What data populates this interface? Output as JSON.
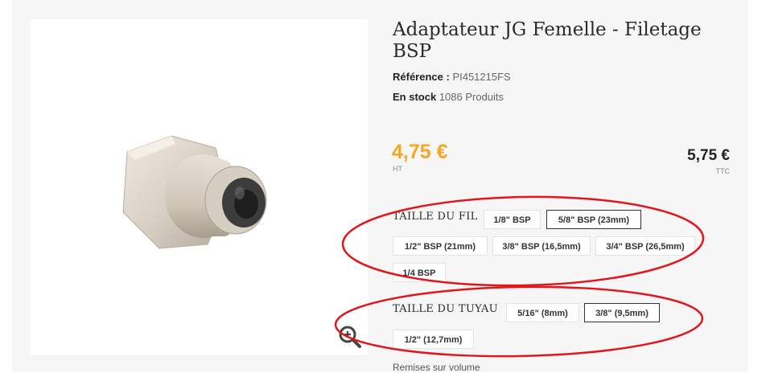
{
  "product": {
    "title": "Adaptateur JG Femelle - Filetage BSP",
    "reference_label": "Référence :",
    "reference_value": "PI451215FS",
    "stock_label": "En stock",
    "stock_value": "1086 Produits"
  },
  "price": {
    "ht_value": "4,75 €",
    "ht_label": "HT",
    "ttc_value": "5,75 €",
    "ttc_label": "TTC",
    "accent_color": "#f5a623"
  },
  "options": {
    "fil": {
      "label": "TAILLE DU FIL",
      "choices": [
        "1/8\" BSP",
        "5/8\" BSP (23mm)",
        "1/2\" BSP (21mm)",
        "3/8\" BSP (16,5mm)",
        "3/4\" BSP (26,5mm)",
        "1/4 BSP"
      ],
      "selected": "5/8\" BSP (23mm)"
    },
    "tuyau": {
      "label": "TAILLE DU TUYAU",
      "choices": [
        "5/16\" (8mm)",
        "3/8\" (9,5mm)",
        "1/2\" (12,7mm)"
      ],
      "selected": "3/8\" (9,5mm)"
    }
  },
  "footer": {
    "remises": "Remises sur volume"
  },
  "icons": {
    "zoom": "zoom-in-icon"
  },
  "annotation_color": "#e0161b"
}
